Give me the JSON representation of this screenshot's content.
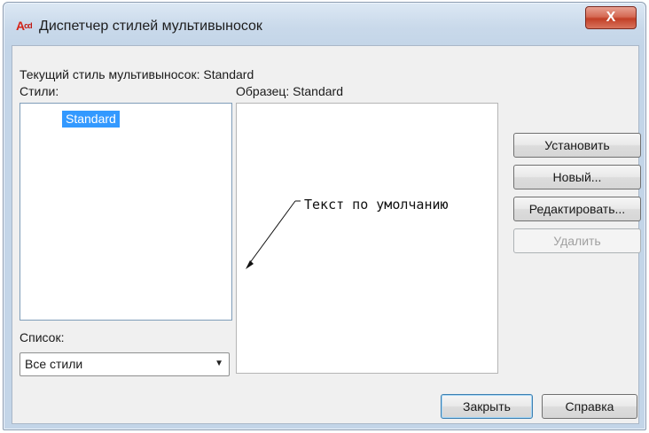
{
  "window": {
    "title": "Диспетчер стилей мультивыносок",
    "icon_text": "A",
    "icon_sub": "cd",
    "close_glyph": "X"
  },
  "current_style": {
    "label": "Текущий стиль мультивыносок: Standard"
  },
  "styles": {
    "label": "Стили:",
    "items": [
      "Standard"
    ],
    "selected": "Standard"
  },
  "list_filter": {
    "label": "Список:",
    "value": "Все стили"
  },
  "preview": {
    "label": "Образец: Standard",
    "leader_text": "Текст по умолчанию"
  },
  "buttons": {
    "set_current": "Установить",
    "new": "Новый...",
    "modify": "Редактировать...",
    "delete": "Удалить",
    "close": "Закрыть",
    "help": "Справка"
  },
  "colors": {
    "selection": "#3399ff",
    "close_button": "#c23f26",
    "icon": "#d62418"
  }
}
